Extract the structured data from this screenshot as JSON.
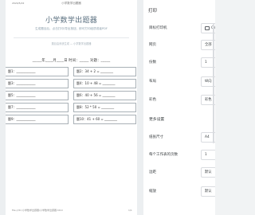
{
  "document": {
    "header_date": "2024/5/22",
    "header_name": "小学数学出题器",
    "title": "小学数学出题器",
    "slogan": "生成题目后，点击打印/导出按钮，即可打印纸质或者PDF",
    "subtitle": "题目由系统生成 — 小学数学出题器",
    "fill_line": "_____年____月____日 时间：_____ 对题：_____",
    "questions": [
      {
        "left": "题1：____________",
        "right": "题2：34 + 2 = ________"
      },
      {
        "left": "题3：____________",
        "right": "题4：10 + 48 = ________"
      },
      {
        "left": "题5：____________",
        "right": "题6：40 + 56 = ________"
      },
      {
        "left": "题7：____________",
        "right": "题8：52 * 50 = ________"
      },
      {
        "left": "题9：____________",
        "right": "题10：41 + 60 = ________"
      }
    ],
    "footer_url": "file:///D:/小学数学出题器/小学数学出题器.html",
    "footer_page": "1/1"
  },
  "print_panel": {
    "title": "打印",
    "destination_label": "目标打印机",
    "destination_value": "Ca",
    "pages_label": "网页",
    "pages_value": "全部",
    "copies_label": "份数",
    "copies_value": "1",
    "layout_label": "布局",
    "layout_value": "纵向",
    "color_label": "彩色",
    "color_value": "彩色",
    "more_settings_label": "更多设置",
    "paper_size_label": "纸张尺寸",
    "paper_size_value": "A4",
    "pages_per_sheet_label": "每个工作表的页数",
    "pages_per_sheet_value": "1",
    "margins_label": "边距",
    "margins_value": "默认",
    "scale_label": "缩放",
    "scale_value": "默认"
  }
}
